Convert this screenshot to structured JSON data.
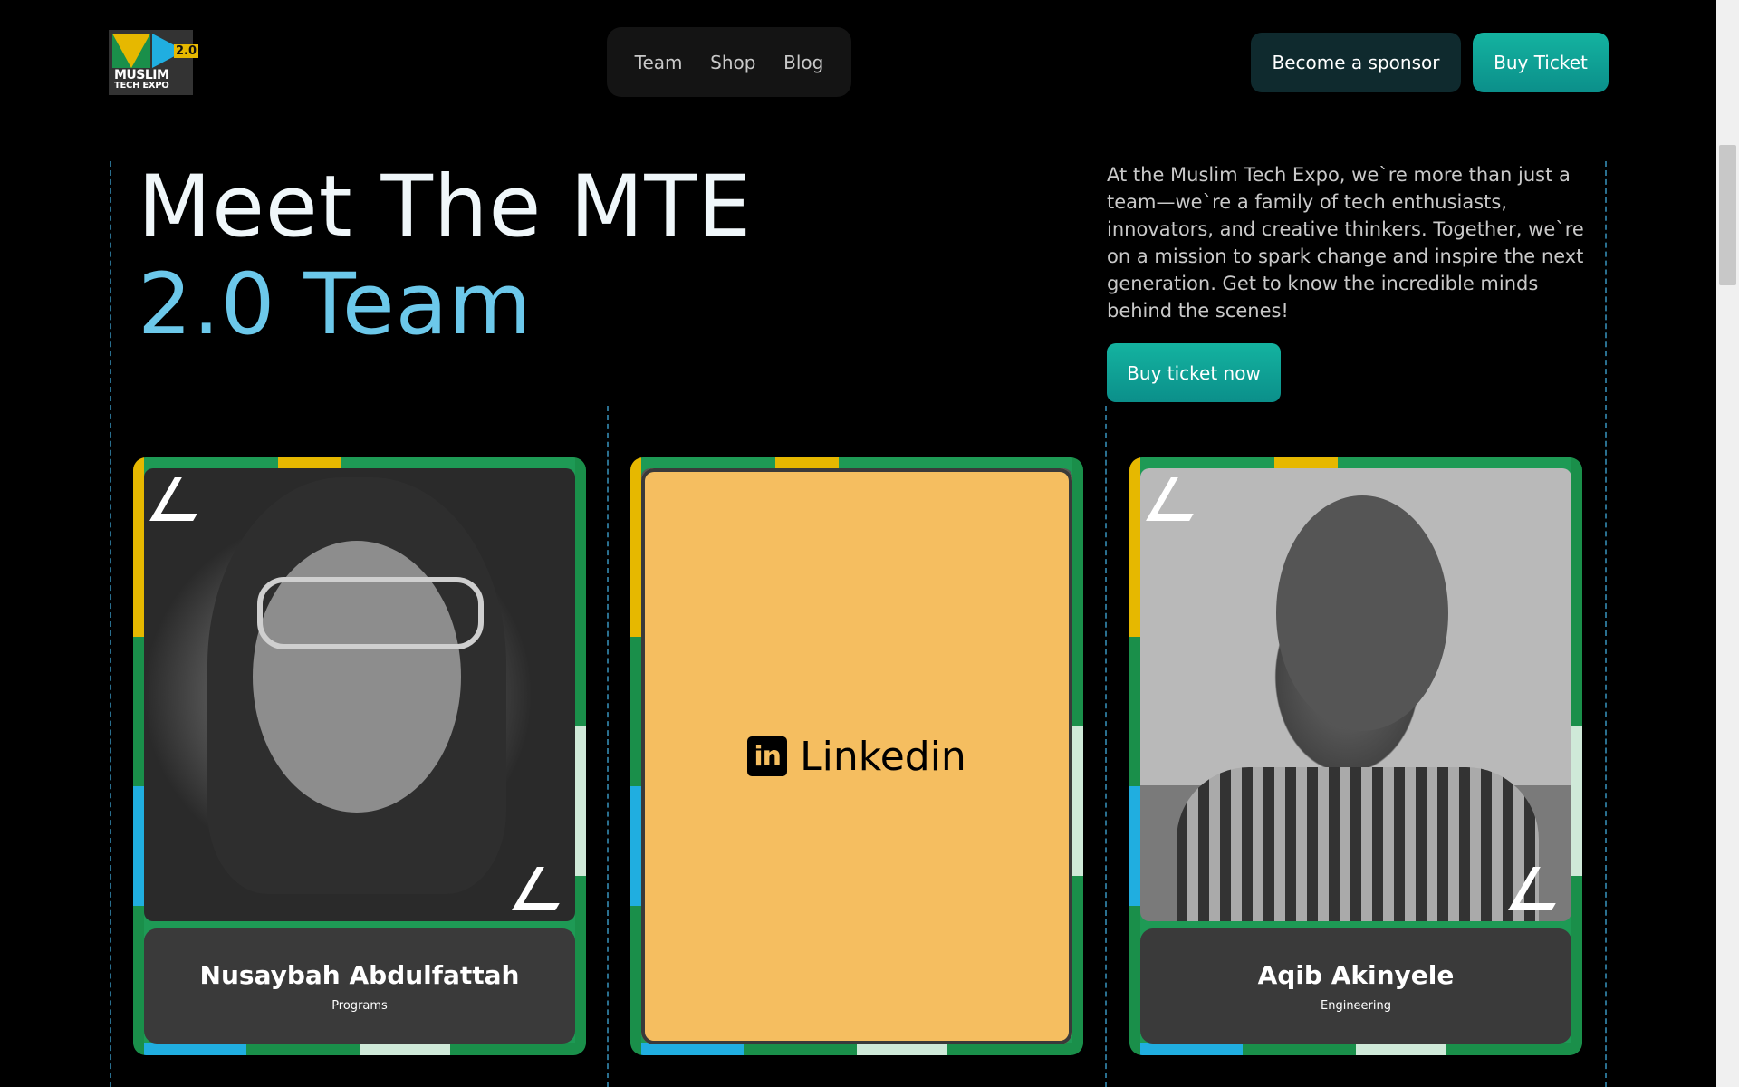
{
  "header": {
    "logo": {
      "version": "2.0",
      "line1": "MUSLIM",
      "line2": "TECH EXPO"
    },
    "nav": [
      "Team",
      "Shop",
      "Blog"
    ],
    "sponsor_label": "Become a sponsor",
    "buy_label": "Buy Ticket"
  },
  "hero": {
    "title_line1": "Meet The MTE",
    "title_line2": "2.0 Team",
    "intro": "At the Muslim Tech Expo, we`re more than just a team—we`re a family of tech enthusiasts, innovators, and creative thinkers. Together, we`re on a mission to spark change and inspire the next generation. Get to know the incredible minds behind the scenes!",
    "cta_label": "Buy ticket now"
  },
  "team": [
    {
      "name": "Nusaybah Abdulfattah",
      "role": "Programs"
    },
    {
      "overlay_icon": "linkedin-icon",
      "overlay_icon_text": "in",
      "overlay_label": "Linkedin"
    },
    {
      "name": "Aqib Akinyele",
      "role": "Engineering"
    }
  ],
  "colors": {
    "accent_teal": "#0b8f8a",
    "title_blue": "#6cc8ea",
    "overlay_yellow": "#f5be60",
    "card_green": "#1e9a55",
    "card_yellow": "#e6b800",
    "card_blue": "#20aee0"
  }
}
